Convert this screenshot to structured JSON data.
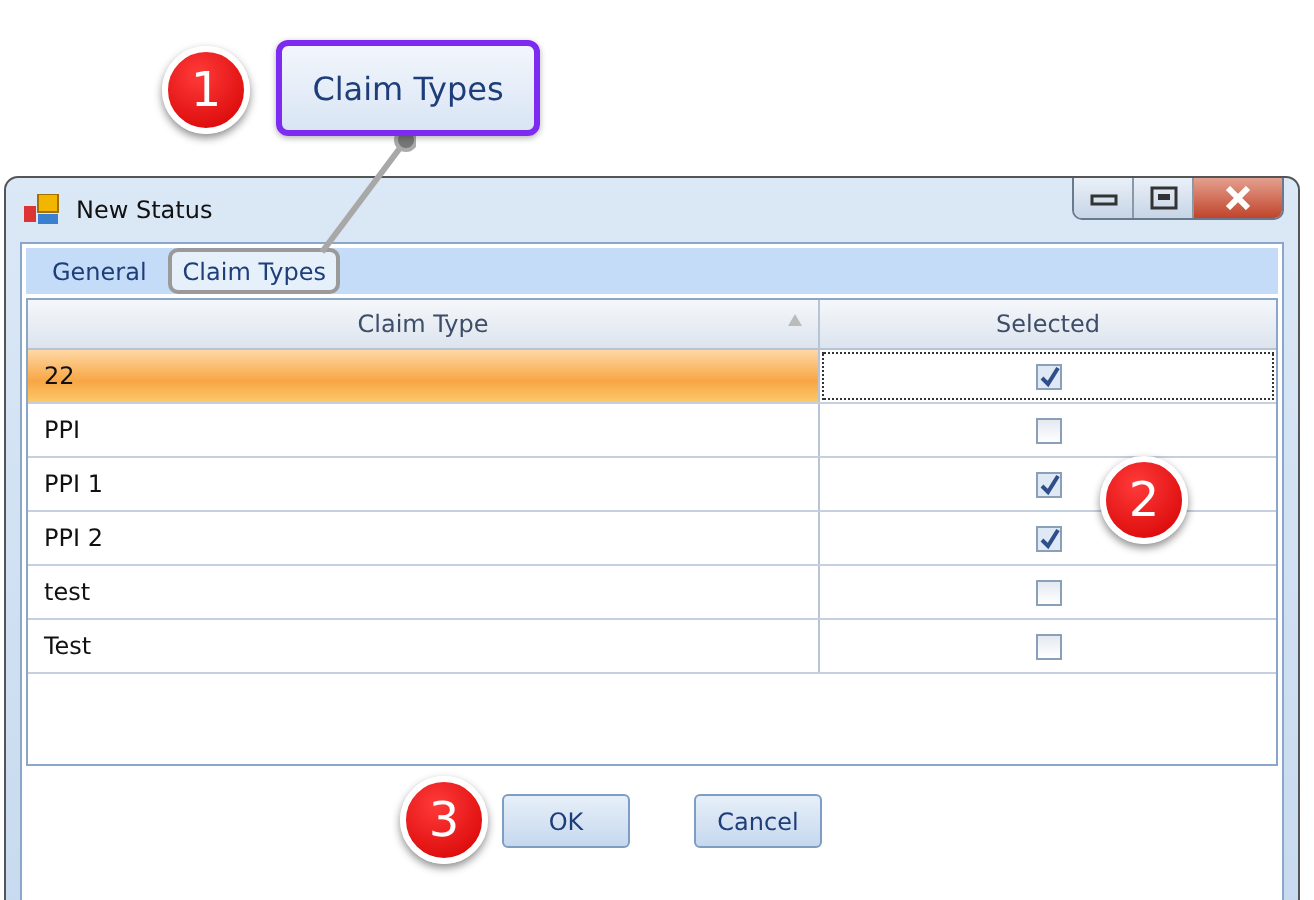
{
  "zoom_callout": {
    "label": "Claim Types"
  },
  "badges": [
    "1",
    "2",
    "3"
  ],
  "window": {
    "title": "New Status"
  },
  "tabs": [
    {
      "label": "General",
      "selected": false
    },
    {
      "label": "Claim Types",
      "selected": true
    }
  ],
  "table": {
    "columns": [
      "Claim Type",
      "Selected"
    ],
    "rows": [
      {
        "claim_type": "22",
        "checked": true,
        "selected": true
      },
      {
        "claim_type": "PPI",
        "checked": false,
        "selected": false
      },
      {
        "claim_type": "PPI 1",
        "checked": true,
        "selected": false
      },
      {
        "claim_type": "PPI 2",
        "checked": true,
        "selected": false
      },
      {
        "claim_type": "test",
        "checked": false,
        "selected": false
      },
      {
        "claim_type": "Test",
        "checked": false,
        "selected": false
      }
    ]
  },
  "buttons": [
    "OK",
    "Cancel"
  ]
}
